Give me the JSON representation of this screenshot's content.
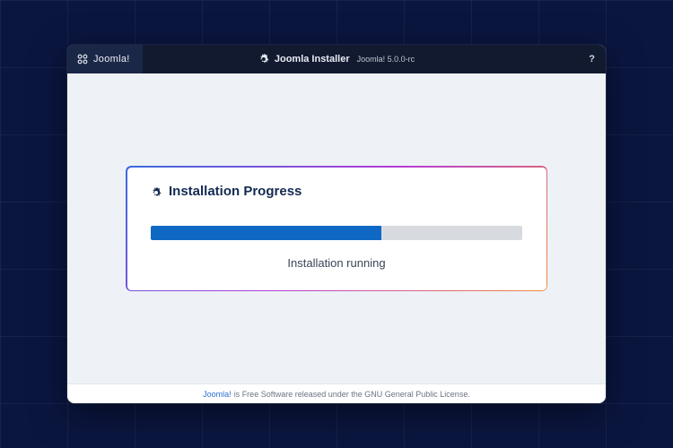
{
  "header": {
    "brand": "Joomla!",
    "title": "Joomla Installer",
    "version": "Joomla! 5.0.0-rc",
    "help": "?"
  },
  "card": {
    "title": "Installation Progress",
    "status": "Installation running",
    "progress_percent": 62
  },
  "footer": {
    "link_text": "Joomla!",
    "text": "is Free Software released under the GNU General Public License."
  },
  "colors": {
    "accent": "#0f69c4",
    "header_bg": "#121a30"
  }
}
